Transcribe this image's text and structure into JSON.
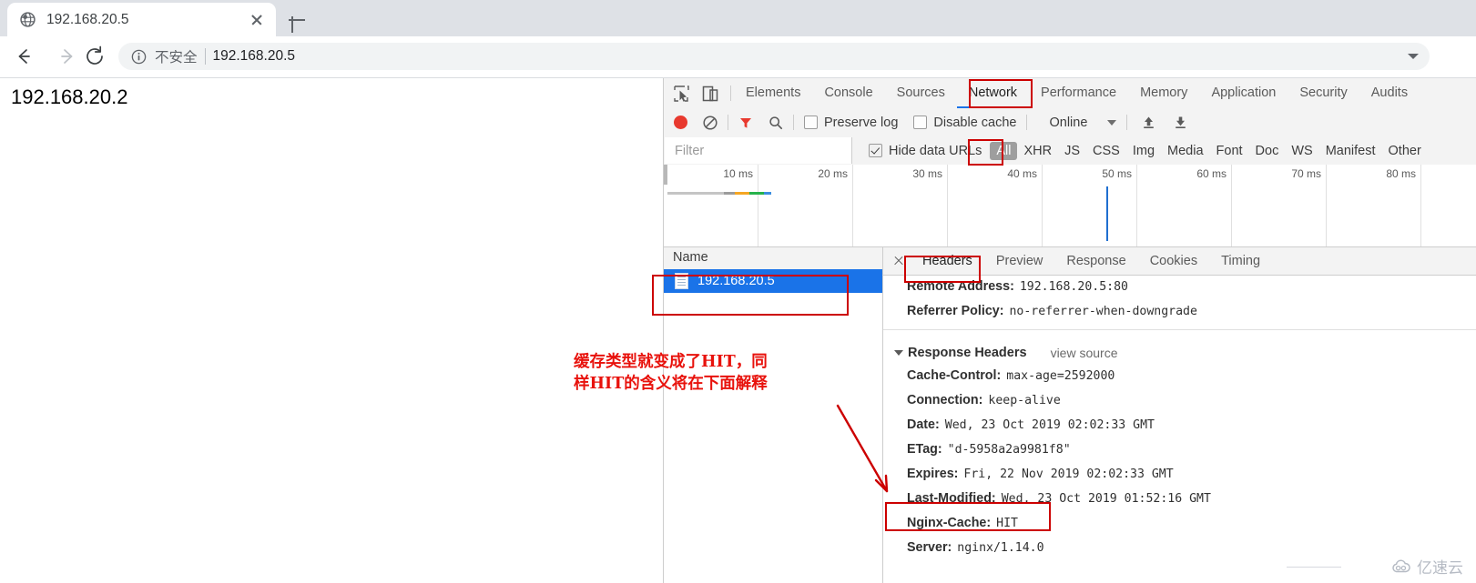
{
  "browser": {
    "tab": {
      "title": "192.168.20.5",
      "favicon_icon": "globe-icon",
      "close_icon": "close-icon"
    },
    "new_tab_icon": "plus-icon",
    "back_icon": "arrow-left-icon",
    "forward_icon": "arrow-right-icon",
    "reload_icon": "reload-icon",
    "omnibox": {
      "security_icon": "info-circle-icon",
      "security_text": "不安全",
      "url": "192.168.20.5",
      "chevron_icon": "chevron-down-icon"
    }
  },
  "page": {
    "body_text": "192.168.20.2"
  },
  "devtools": {
    "inspect_icon": "inspect-element-icon",
    "device_icon": "toggle-device-toolbar-icon",
    "tabs": [
      {
        "label": "Elements",
        "selected": false
      },
      {
        "label": "Console",
        "selected": false
      },
      {
        "label": "Sources",
        "selected": false
      },
      {
        "label": "Network",
        "selected": true
      },
      {
        "label": "Performance",
        "selected": false
      },
      {
        "label": "Memory",
        "selected": false
      },
      {
        "label": "Application",
        "selected": false
      },
      {
        "label": "Security",
        "selected": false
      },
      {
        "label": "Audits",
        "selected": false
      }
    ],
    "network_toolbar": {
      "record_icon": "record-icon",
      "clear_icon": "clear-icon",
      "filter_icon": "filter-funnel-icon",
      "search_icon": "search-icon",
      "preserve_log_label": "Preserve log",
      "preserve_log_checked": false,
      "disable_cache_label": "Disable cache",
      "disable_cache_checked": false,
      "throttle_value": "Online",
      "throttle_chevron_icon": "chevron-down-icon",
      "import_har_icon": "upload-arrow-icon",
      "export_har_icon": "download-arrow-icon"
    },
    "filter_row": {
      "filter_placeholder": "Filter",
      "hide_data_urls_label": "Hide data URLs",
      "hide_data_urls_checked": true,
      "type_filters": [
        {
          "label": "All",
          "active": true
        },
        {
          "label": "XHR",
          "active": false
        },
        {
          "label": "JS",
          "active": false
        },
        {
          "label": "CSS",
          "active": false
        },
        {
          "label": "Img",
          "active": false
        },
        {
          "label": "Media",
          "active": false
        },
        {
          "label": "Font",
          "active": false
        },
        {
          "label": "Doc",
          "active": false
        },
        {
          "label": "WS",
          "active": false
        },
        {
          "label": "Manifest",
          "active": false
        },
        {
          "label": "Other",
          "active": false
        }
      ]
    },
    "timeline": {
      "tick_labels": [
        "10 ms",
        "20 ms",
        "30 ms",
        "40 ms",
        "50 ms",
        "60 ms",
        "70 ms",
        "80 ms"
      ],
      "request_bar_segments": [
        {
          "name": "queueing",
          "color": "#c4c4c4",
          "width": 62
        },
        {
          "name": "stalled",
          "color": "#9b9b9b",
          "width": 12
        },
        {
          "name": "waiting",
          "color": "#f5a623",
          "width": 16
        },
        {
          "name": "content-download",
          "color": "#26b24b",
          "width": 16
        },
        {
          "name": "finish",
          "color": "#3b8ee0",
          "width": 8
        }
      ],
      "load_event_color": "#1f6fd0"
    },
    "requests": {
      "column_header": "Name",
      "rows": [
        {
          "name": "192.168.20.5",
          "icon": "document-icon",
          "selected": true
        }
      ]
    },
    "detail": {
      "close_icon": "close-icon",
      "tabs": [
        {
          "label": "Headers",
          "selected": true
        },
        {
          "label": "Preview",
          "selected": false
        },
        {
          "label": "Response",
          "selected": false
        },
        {
          "label": "Cookies",
          "selected": false
        },
        {
          "label": "Timing",
          "selected": false
        }
      ],
      "general_headers": [
        {
          "name": "Remote Address:",
          "value": "192.168.20.5:80"
        },
        {
          "name": "Referrer Policy:",
          "value": "no-referrer-when-downgrade"
        }
      ],
      "response_headers_title": "Response Headers",
      "response_headers_triangle_icon": "triangle-down-icon",
      "view_source_label": "view source",
      "response_headers": [
        {
          "name": "Cache-Control:",
          "value": "max-age=2592000"
        },
        {
          "name": "Connection:",
          "value": "keep-alive"
        },
        {
          "name": "Date:",
          "value": "Wed, 23 Oct 2019 02:02:33 GMT"
        },
        {
          "name": "ETag:",
          "value": "\"d-5958a2a9981f8\""
        },
        {
          "name": "Expires:",
          "value": "Fri, 22 Nov 2019 02:02:33 GMT"
        },
        {
          "name": "Last-Modified:",
          "value": "Wed, 23 Oct 2019 01:52:16 GMT"
        },
        {
          "name": "Nginx-Cache:",
          "value": "HIT"
        },
        {
          "name": "Server:",
          "value": "nginx/1.14.0"
        }
      ]
    }
  },
  "annotations": {
    "color": "#cc0000",
    "text_color": "#e8120c",
    "note_line1": "缓存类型就变成了HIT，同",
    "note_line2": "样HIT的含义将在下面解释"
  },
  "watermark": {
    "text": "亿速云",
    "icon": "cloud-icon"
  }
}
